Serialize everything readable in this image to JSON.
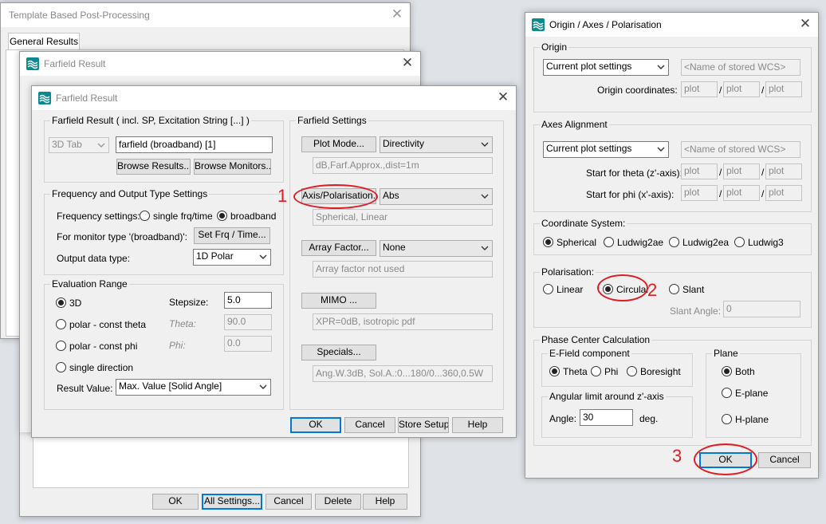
{
  "tpp": {
    "title": "Template Based Post-Processing",
    "tab": "General Results",
    "buttons": {
      "ok": "OK",
      "all": "All Settings...",
      "cancel": "Cancel",
      "delete": "Delete",
      "help": "Help"
    }
  },
  "ff_back": {
    "title": "Farfield Result"
  },
  "ff": {
    "title": "Farfield Result",
    "result_group": "Farfield Result ( incl. SP, Excitation String [...] )",
    "type_combo": "3D Tab",
    "name_field": "farfield (broadband) [1]",
    "browse_results": "Browse Results...",
    "browse_monitors": "Browse Monitors...",
    "freq_group": "Frequency and Output Type Settings",
    "freq_label": "Frequency settings:",
    "radio_single": "single frq/time",
    "radio_broadband": "broadband",
    "monitor_label": "For monitor type '(broadband)':",
    "set_frq": "Set Frq / Time...",
    "output_label": "Output data type:",
    "output_value": "1D Polar",
    "eval_group": "Evaluation Range",
    "radio_3d": "3D",
    "radio_theta": "polar - const theta",
    "radio_phi": "polar - const phi",
    "radio_single_dir": "single direction",
    "stepsize_label": "Stepsize:",
    "stepsize_value": "5.0",
    "theta_label": "Theta:",
    "theta_value": "90.0",
    "phi_label": "Phi:",
    "phi_value": "0.0",
    "result_value_label": "Result Value:",
    "result_value": "Max. Value [Solid Angle]",
    "settings_group": "Farfield Settings",
    "plot_mode": "Plot Mode...",
    "plot_mode_value": "Directivity",
    "plot_mode_desc": "dB,Farf.Approx.,dist=1m",
    "axis_pol": "Axis/Polarisation...",
    "axis_pol_value": "Abs",
    "axis_pol_desc": "Spherical, Linear",
    "array_factor": "Array Factor...",
    "array_factor_value": "None",
    "array_factor_desc": "Array factor not used",
    "mimo": "MIMO ...",
    "mimo_desc": "XPR=0dB, isotropic pdf",
    "specials": "Specials...",
    "specials_desc": "Ang.W.3dB, Sol.A.:0...180/0...360,0.5W",
    "ok": "OK",
    "cancel": "Cancel",
    "store": "Store Setup",
    "help": "Help"
  },
  "oap": {
    "title": "Origin / Axes / Polarisation",
    "origin_group": "Origin",
    "origin_combo": "Current plot settings",
    "stored_wcs": "<Name of stored WCS>",
    "origin_coords_label": "Origin coordinates:",
    "plot": "plot",
    "slash": "/",
    "axes_group": "Axes Alignment",
    "axes_combo": "Current plot settings",
    "start_theta_label": "Start for theta (z'-axis):",
    "start_phi_label": "Start for phi (x'-axis):",
    "coord_group": "Coordinate System:",
    "cs_spherical": "Spherical",
    "cs_ludwig2ae": "Ludwig2ae",
    "cs_ludwig2ea": "Ludwig2ea",
    "cs_ludwig3": "Ludwig3",
    "pol_group": "Polarisation:",
    "pol_linear": "Linear",
    "pol_circular": "Circular",
    "pol_slant": "Slant",
    "slant_angle_label": "Slant Angle:",
    "slant_angle_value": "0",
    "phase_group": "Phase Center Calculation",
    "efield_group": "E-Field component",
    "ef_theta": "Theta",
    "ef_phi": "Phi",
    "ef_boresight": "Boresight",
    "plane_group": "Plane",
    "pl_both": "Both",
    "pl_e": "E-plane",
    "pl_h": "H-plane",
    "angular_group": "Angular limit around z'-axis",
    "angle_label": "Angle:",
    "angle_value": "30",
    "deg": "deg.",
    "ok": "OK",
    "cancel": "Cancel"
  },
  "annotations": {
    "one": "1",
    "two": "2",
    "three": "3"
  },
  "colors": {
    "annotation": "#e01b24",
    "focus": "#0078d7",
    "app_icon": "#0a8a8f"
  },
  "icons": {
    "app": "cst-wave-icon",
    "close": "close-icon",
    "dropdown": "chevron-down-icon"
  }
}
